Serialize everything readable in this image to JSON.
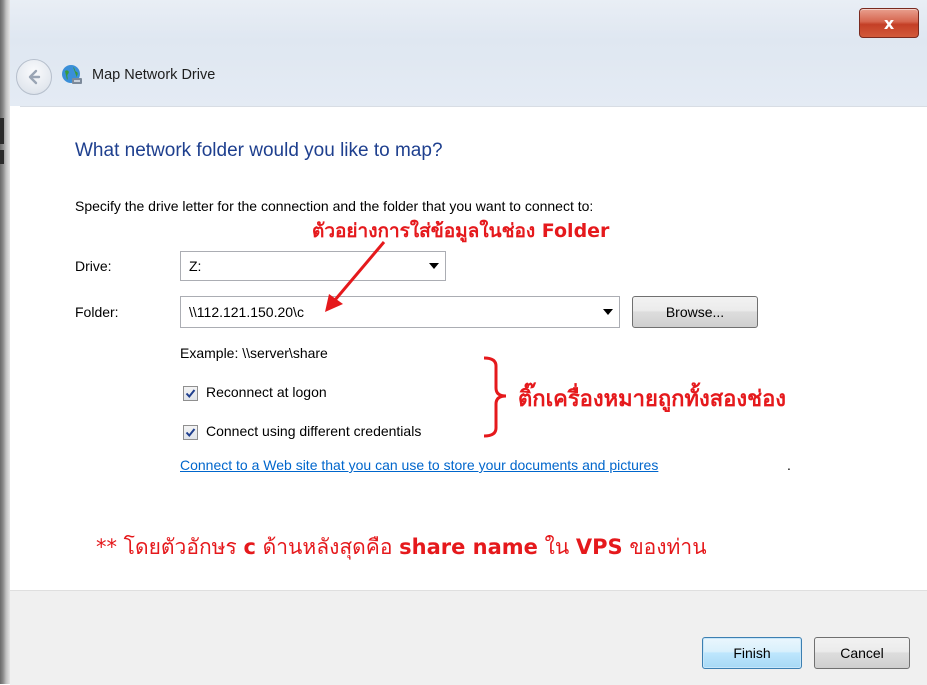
{
  "window": {
    "title": "Map Network Drive",
    "close_glyph": "x",
    "icons": {
      "back": "back-arrow-icon",
      "app": "network-globe-icon",
      "close": "close-icon"
    }
  },
  "dialog": {
    "heading": "What network folder would you like to map?",
    "instruction": "Specify the drive letter for the connection and the folder that you want to connect to:",
    "drive": {
      "label": "Drive:",
      "value": "Z:"
    },
    "folder": {
      "label": "Folder:",
      "value": "\\\\112.121.150.20\\c",
      "browse_label": "Browse..."
    },
    "example": "Example: \\\\server\\share",
    "reconnect": {
      "label": "Reconnect at logon",
      "checked": true
    },
    "credentials": {
      "label": "Connect using different credentials",
      "checked": true
    },
    "link": {
      "text": "Connect to a Web site that you can use to store your documents and pictures",
      "trailing": "."
    }
  },
  "footer": {
    "finish_label": "Finish",
    "cancel_label": "Cancel"
  },
  "annotations": {
    "folder_example_regular": "ตัวอย่างการใส่ข้อมูลในช่อง",
    "folder_example_bold": "Folder",
    "tick_both": "ติ๊กเครื่องหมายถูกทั้งสองช่อง",
    "note_parts": [
      {
        "text": "** โดยตัวอักษร ",
        "bold": false
      },
      {
        "text": "c",
        "bold": true
      },
      {
        "text": " ด้านหลังสุดคือ ",
        "bold": false
      },
      {
        "text": "share name",
        "bold": true
      },
      {
        "text": " ใน ",
        "bold": false
      },
      {
        "text": "VPS",
        "bold": true
      },
      {
        "text": " ของท่าน",
        "bold": false
      }
    ],
    "color": "#e5191c"
  }
}
